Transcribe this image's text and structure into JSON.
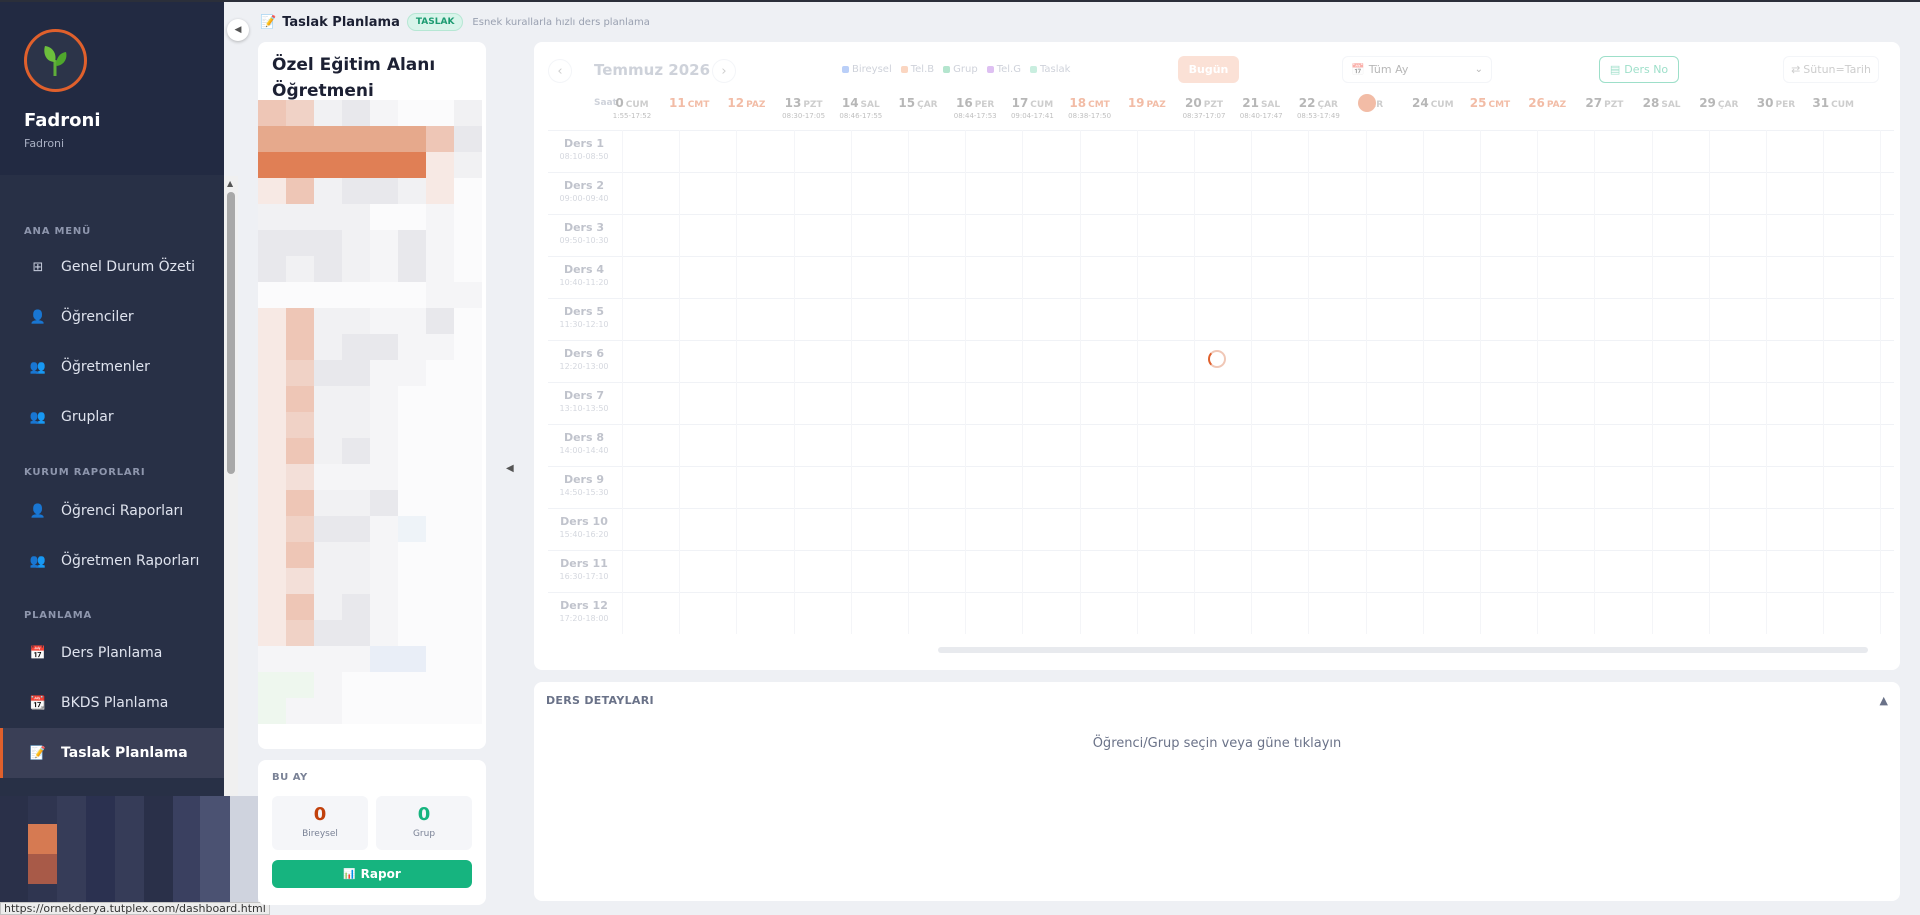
{
  "brand": {
    "name": "Fadroni",
    "sub": "Fadroni"
  },
  "sidebar": {
    "sections": [
      {
        "label": "ANA MENÜ"
      },
      {
        "label": "KURUM RAPORLARI"
      },
      {
        "label": "PLANLAMA"
      }
    ],
    "items": [
      {
        "label": "Genel Durum Özeti",
        "icon": "grid-icon"
      },
      {
        "label": "Öğrenciler",
        "icon": "student-icon"
      },
      {
        "label": "Öğretmenler",
        "icon": "teacher-icon"
      },
      {
        "label": "Gruplar",
        "icon": "group-icon"
      },
      {
        "label": "Öğrenci Raporları",
        "icon": "student-report-icon"
      },
      {
        "label": "Öğretmen Raporları",
        "icon": "teacher-report-icon"
      },
      {
        "label": "Ders Planlama",
        "icon": "calendar-icon"
      },
      {
        "label": "BKDS Planlama",
        "icon": "calendar-one-icon"
      },
      {
        "label": "Taslak Planlama",
        "icon": "memo-icon",
        "active": true
      }
    ]
  },
  "header": {
    "title": "Taslak Planlama",
    "badge": "TASLAK",
    "subtitle": "Esnek kurallarla hızlı ders planlama"
  },
  "left_panel": {
    "title": "Özel Eğitim Alanı Öğretmeni"
  },
  "summary": {
    "label": "BU AY",
    "stats": [
      {
        "value": "0",
        "label": "Bireysel",
        "color": "#c2410c"
      },
      {
        "value": "0",
        "label": "Grup",
        "color": "#16b47f"
      }
    ],
    "report_button": "Rapor"
  },
  "calendar": {
    "month": "Temmuz 2026",
    "legend": [
      {
        "label": "Bireysel",
        "color": "#5b8def"
      },
      {
        "label": "Tel.B",
        "color": "#f59e6b"
      },
      {
        "label": "Grup",
        "color": "#4cc08a"
      },
      {
        "label": "Tel.G",
        "color": "#b06ae0"
      },
      {
        "label": "Taslak",
        "color": "#7fd6b4"
      }
    ],
    "today_button": "Bugün",
    "month_select": "Tüm Ay",
    "ders_no_button": "Ders No",
    "sutun_button": "Sütun=Tarih",
    "saat_label": "Saat",
    "days": [
      {
        "num": "0",
        "dow": "CUM",
        "hours": "1:55-17:52"
      },
      {
        "num": "11",
        "dow": "CMT",
        "hours": "",
        "weekend": true
      },
      {
        "num": "12",
        "dow": "PAZ",
        "hours": "",
        "weekend": true
      },
      {
        "num": "13",
        "dow": "PZT",
        "hours": "08:30-17:05"
      },
      {
        "num": "14",
        "dow": "SAL",
        "hours": "08:46-17:55"
      },
      {
        "num": "15",
        "dow": "ÇAR",
        "hours": ""
      },
      {
        "num": "16",
        "dow": "PER",
        "hours": "08:44-17:53"
      },
      {
        "num": "17",
        "dow": "CUM",
        "hours": "09:04-17:41"
      },
      {
        "num": "18",
        "dow": "CMT",
        "hours": "08:38-17:50",
        "weekend": true
      },
      {
        "num": "19",
        "dow": "PAZ",
        "hours": "",
        "weekend": true
      },
      {
        "num": "20",
        "dow": "PZT",
        "hours": "08:37-17:07"
      },
      {
        "num": "21",
        "dow": "SAL",
        "hours": "08:40-17:47"
      },
      {
        "num": "22",
        "dow": "ÇAR",
        "hours": "08:53-17:49"
      },
      {
        "num": "",
        "dow": "ER",
        "hours": "",
        "today": true
      },
      {
        "num": "24",
        "dow": "CUM",
        "hours": ""
      },
      {
        "num": "25",
        "dow": "CMT",
        "hours": "",
        "weekend": true
      },
      {
        "num": "26",
        "dow": "PAZ",
        "hours": "",
        "weekend": true
      },
      {
        "num": "27",
        "dow": "PZT",
        "hours": ""
      },
      {
        "num": "28",
        "dow": "SAL",
        "hours": ""
      },
      {
        "num": "29",
        "dow": "ÇAR",
        "hours": ""
      },
      {
        "num": "30",
        "dow": "PER",
        "hours": ""
      },
      {
        "num": "31",
        "dow": "CUM",
        "hours": ""
      }
    ],
    "lessons": [
      {
        "name": "Ders 1",
        "time": "08:10-08:50"
      },
      {
        "name": "Ders 2",
        "time": "09:00-09:40"
      },
      {
        "name": "Ders 3",
        "time": "09:50-10:30"
      },
      {
        "name": "Ders 4",
        "time": "10:40-11:20"
      },
      {
        "name": "Ders 5",
        "time": "11:30-12:10"
      },
      {
        "name": "Ders 6",
        "time": "12:20-13:00"
      },
      {
        "name": "Ders 7",
        "time": "13:10-13:50"
      },
      {
        "name": "Ders 8",
        "time": "14:00-14:40"
      },
      {
        "name": "Ders 9",
        "time": "14:50-15:30"
      },
      {
        "name": "Ders 10",
        "time": "15:40-16:20"
      },
      {
        "name": "Ders 11",
        "time": "16:30-17:10"
      },
      {
        "name": "Ders 12",
        "time": "17:20-18:00"
      }
    ]
  },
  "details": {
    "title": "DERS DETAYLARI",
    "empty": "Öğrenci/Grup seçin veya güne tıklayın"
  },
  "status_url": "https://ornekderya.tutplex.com/dashboard.html"
}
